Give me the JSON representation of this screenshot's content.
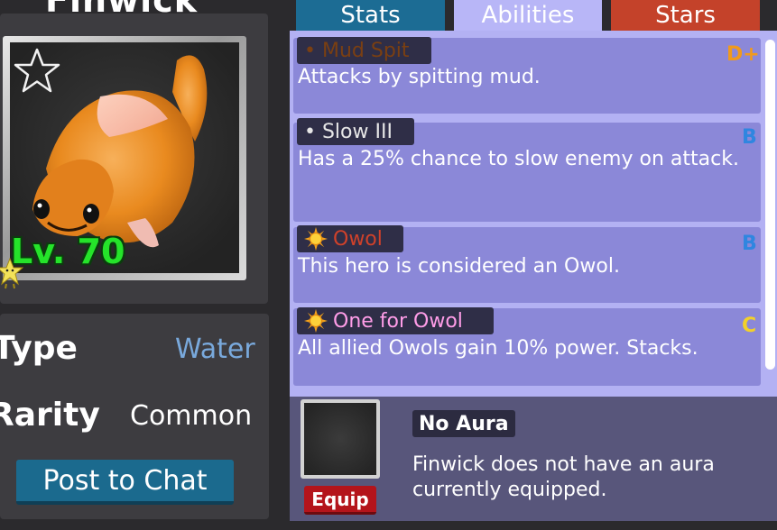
{
  "hero": {
    "name": "Finwick",
    "level_text": "Lv. 70",
    "favorited": false
  },
  "info": {
    "type_label": "Type",
    "type_value": "Water",
    "rarity_label": "Rarity",
    "rarity_value": "Common",
    "post_button": "Post to Chat"
  },
  "tabs": [
    {
      "label": "Stats",
      "active": false
    },
    {
      "label": "Abilities",
      "active": true
    },
    {
      "label": "Stars",
      "active": false
    }
  ],
  "abilities": [
    {
      "name": "• Mud Spit",
      "description": "Attacks by spitting mud.",
      "grade": "D+",
      "grade_color": "#f09a1c",
      "icon": "bullet"
    },
    {
      "name": "• Slow III",
      "description": "Has a 25% chance to slow enemy on attack.",
      "grade": "B",
      "grade_color": "#2f86e0",
      "icon": "bullet"
    },
    {
      "name": "Owol",
      "description": "This hero is considered an Owol.",
      "grade": "B",
      "grade_color": "#2f86e0",
      "icon": "sun-icon"
    },
    {
      "name": "One for Owol",
      "description": "All allied Owols gain 10% power. Stacks.",
      "grade": "C",
      "grade_color": "#f2d02a",
      "icon": "sun-icon"
    }
  ],
  "aura": {
    "name": "No Aura",
    "description": "Finwick does not have an aura currently equipped.",
    "equip_button": "Equip"
  },
  "colors": {
    "background": "#2b2a2d",
    "panel": "#3d3c40",
    "abilities_panel": "#b3b1f3",
    "ability_card": "#8b88d8",
    "aura_panel": "#58567b",
    "level_green": "#25e32a",
    "type_blue": "#79a9dc",
    "post_button": "#1b6a8e",
    "equip_button": "#b4141b",
    "tab_stats": "#1c6c94",
    "tab_stars": "#c4422a"
  }
}
